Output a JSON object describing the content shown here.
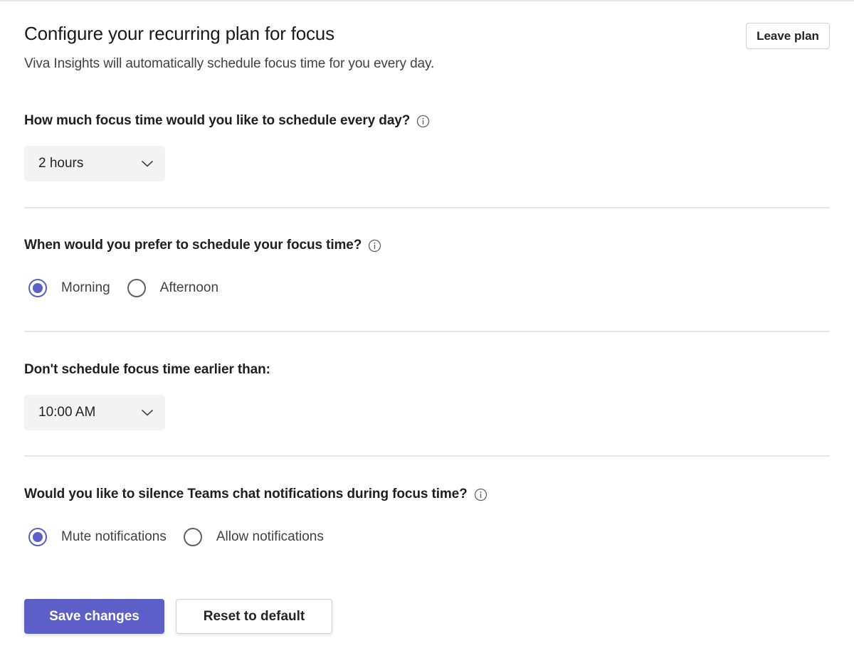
{
  "header": {
    "title": "Configure your recurring plan for focus",
    "subtitle": "Viva Insights will automatically schedule focus time for you every day.",
    "leave_plan_label": "Leave plan"
  },
  "sections": {
    "duration": {
      "question": "How much focus time would you like to schedule every day?",
      "icon": "info-icon",
      "selected_value": "2 hours"
    },
    "time_of_day": {
      "question": "When would you prefer to schedule your focus time?",
      "icon": "info-icon",
      "options": [
        {
          "label": "Morning",
          "checked": true
        },
        {
          "label": "Afternoon",
          "checked": false
        }
      ]
    },
    "earliest_time": {
      "question": "Don't schedule focus time earlier than:",
      "selected_value": "10:00 AM"
    },
    "notifications": {
      "question": "Would you like to silence Teams chat notifications during focus time?",
      "icon": "info-icon",
      "options": [
        {
          "label": "Mute notifications",
          "checked": true
        },
        {
          "label": "Allow notifications",
          "checked": false
        }
      ]
    }
  },
  "footer": {
    "save_label": "Save changes",
    "reset_label": "Reset to default"
  },
  "colors": {
    "accent": "#5b5fc7",
    "divider": "#e6e6e6",
    "dropdown_bg": "#f3f3f3"
  }
}
